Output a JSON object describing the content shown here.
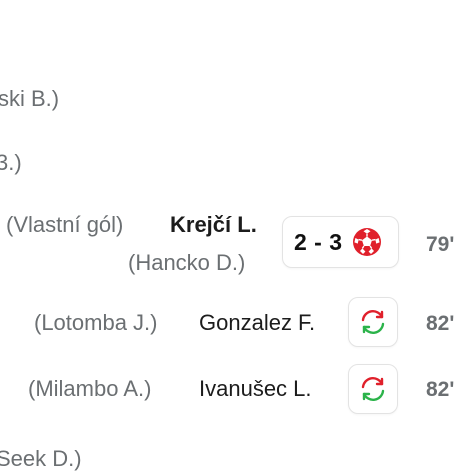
{
  "rows": [
    {
      "assist": "ski B.)"
    },
    {
      "assist": "3.)"
    },
    {
      "extra": "(Vlastní gól)",
      "player": "Krejčí L.",
      "assist": "(Hancko D.)",
      "score": "2 - 3",
      "icon": "soccer-ball-icon",
      "minute": "79'"
    },
    {
      "assist": "(Lotomba J.)",
      "player": "Gonzalez F.",
      "icon": "substitution-icon",
      "minute": "82'"
    },
    {
      "assist": "(Milambo A.)",
      "player": "Ivanušec L.",
      "icon": "substitution-icon",
      "minute": "82'"
    },
    {
      "assist": "Seek D.)"
    }
  ],
  "colors": {
    "goal_red": "#e0202b",
    "sub_green": "#2bb34a",
    "sub_red": "#e0202b"
  }
}
